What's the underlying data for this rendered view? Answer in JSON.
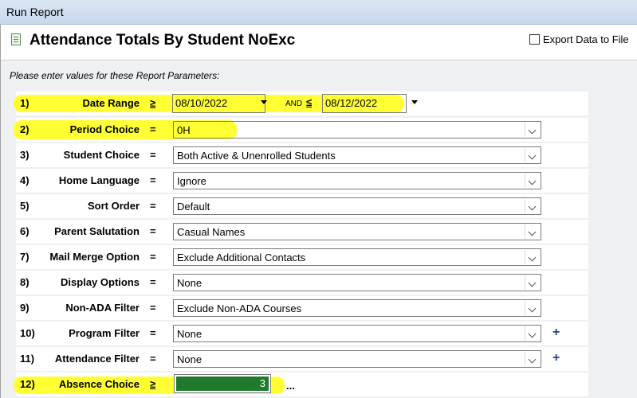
{
  "window": {
    "title": "Run Report"
  },
  "header": {
    "report_title": "Attendance Totals By Student NoExc",
    "export_label": "Export Data to File",
    "export_checked": false
  },
  "prompt": "Please enter values for these Report Parameters:",
  "params": [
    {
      "num": "1)",
      "label": "Date Range",
      "op": "≥",
      "from": "08/10/2022",
      "and": "AND",
      "op2": "≤",
      "to": "08/12/2022"
    },
    {
      "num": "2)",
      "label": "Period Choice",
      "op": "=",
      "value": "0H"
    },
    {
      "num": "3)",
      "label": "Student Choice",
      "op": "=",
      "value": "Both Active & Unenrolled Students"
    },
    {
      "num": "4)",
      "label": "Home Language",
      "op": "=",
      "value": "Ignore"
    },
    {
      "num": "5)",
      "label": "Sort Order",
      "op": "=",
      "value": "Default"
    },
    {
      "num": "6)",
      "label": "Parent Salutation",
      "op": "=",
      "value": "Casual Names"
    },
    {
      "num": "7)",
      "label": "Mail Merge Option",
      "op": "=",
      "value": "Exclude Additional Contacts"
    },
    {
      "num": "8)",
      "label": "Display Options",
      "op": "=",
      "value": "None"
    },
    {
      "num": "9)",
      "label": "Non-ADA Filter",
      "op": "=",
      "value": "Exclude Non-ADA Courses"
    },
    {
      "num": "10)",
      "label": "Program Filter",
      "op": "=",
      "value": "None",
      "plus": "+"
    },
    {
      "num": "11)",
      "label": "Attendance Filter",
      "op": "=",
      "value": "None",
      "plus": "+"
    },
    {
      "num": "12)",
      "label": "Absence Choice",
      "op": "≥",
      "value": "3",
      "extra": "..."
    }
  ],
  "colors": {
    "highlight": "#ffff33",
    "selected_fill": "#1f7a2e",
    "plus": "#2a3b8f"
  }
}
